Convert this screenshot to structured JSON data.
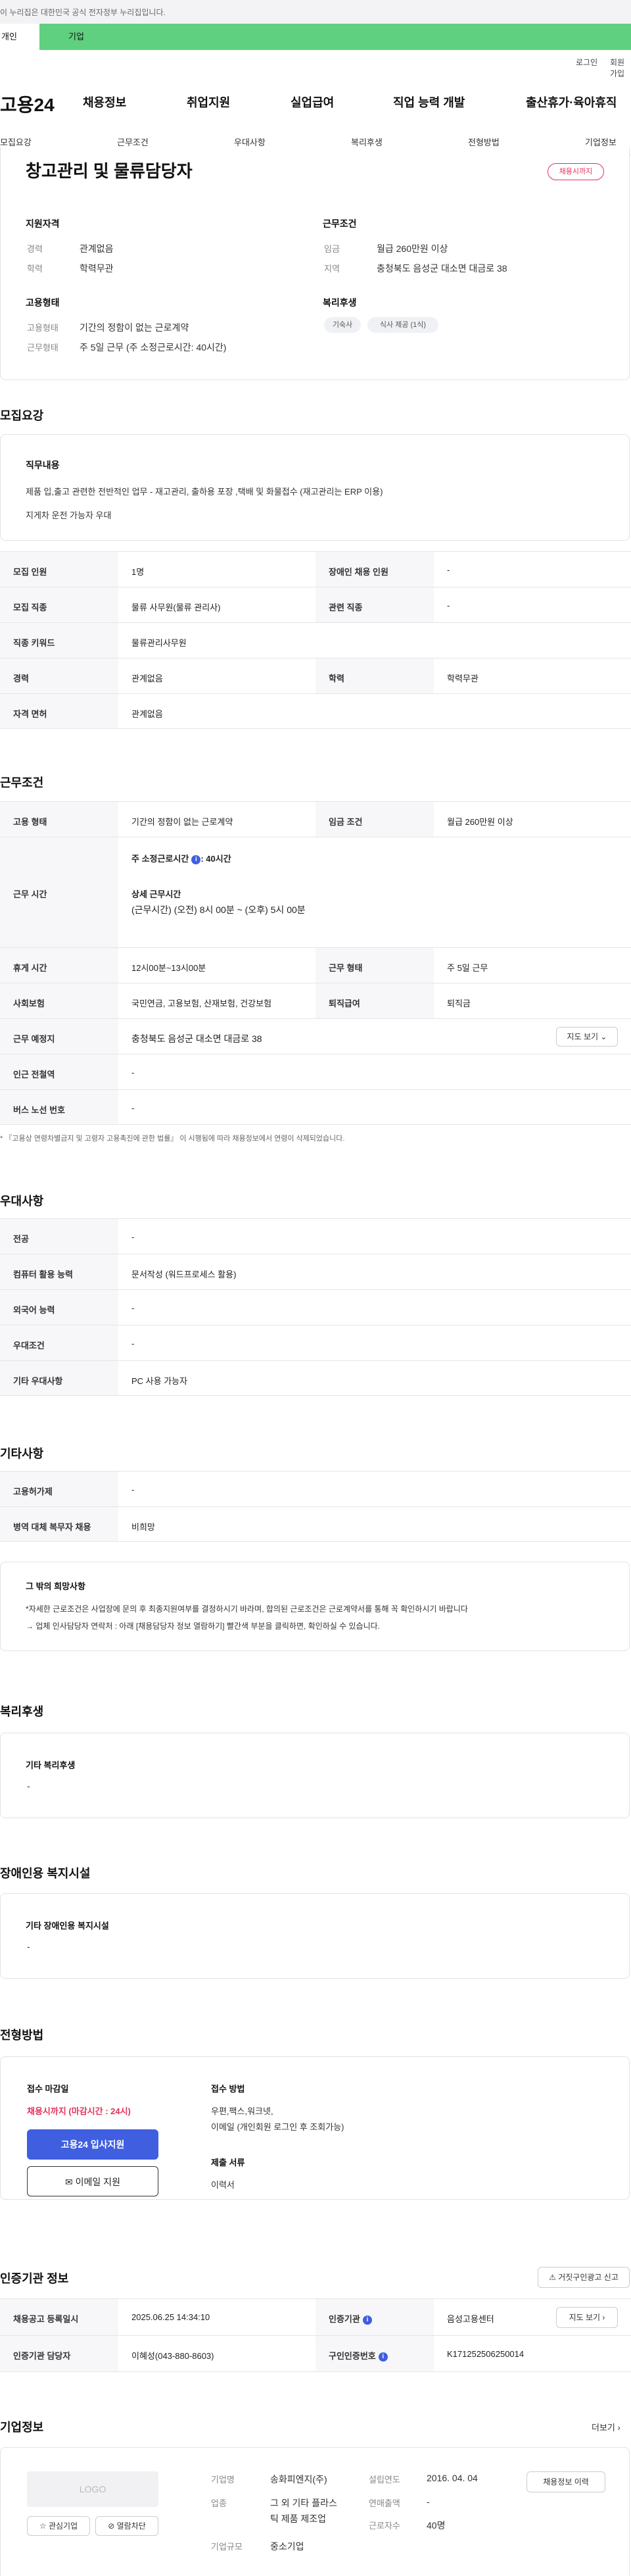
{
  "topbar": {
    "notice": "이 누리집은 대한민국 공식 전자정부 누리집입니다."
  },
  "greenbar": {
    "tab1": "개인",
    "tab2": "기업"
  },
  "utils": {
    "login": "로그인",
    "join": "회원가입"
  },
  "gnb": {
    "logo": "고용24",
    "m1": "채용정보",
    "m2": "취업지원",
    "m3": "실업급여",
    "m4": "직업 능력 개발",
    "m5": "출산휴가·육아휴직"
  },
  "anchor": {
    "a1": "모집요강",
    "a2": "근무조건",
    "a3": "우대사항",
    "a4": "복리후생",
    "a5": "전형방법",
    "a6": "기업정보"
  },
  "summary": {
    "title": "창고관리 및 물류담당자",
    "badge": "채용시까지",
    "qual_title": "지원자격",
    "career_l": "경력",
    "career_v": "관계없음",
    "edu_l": "학력",
    "edu_v": "학력무관",
    "emp_title": "고용형태",
    "emptype_l": "고용형태",
    "emptype_v": "기간의 정함이 없는 근로계약",
    "worktype_l": "근무형태",
    "worktype_v": "주 5일 근무 (주 소정근로시간: 40시간)",
    "cond_title": "근무조건",
    "wage_l": "임금",
    "wage_v": "월급 260만원 이상",
    "region_l": "지역",
    "region_v": "충청북도 음성군 대소면 대금로 38",
    "welfare_title": "복리후생",
    "chip1": "기숙사",
    "chip2": "식사 제공 (1식)"
  },
  "recruit": {
    "heading": "모집요강",
    "duty_title": "직무내용",
    "duty1": "제품 입,출고  관련한 전반적인 업무  -  재고관리, 출하용 포장 ,택배 및 화물접수 (재고관리는 ERP 이용)",
    "duty2": "지게차 운전 가능자 우대",
    "r1c1": "모집 인원",
    "r1c2": "1명",
    "r1c3": "장애인 채용 인원",
    "r1c4": "-",
    "r2c1": "모집 직종",
    "r2c2": "물류 사무원(물류 관리사)",
    "r2c3": "관련 직종",
    "r2c4": "-",
    "r3c1": "직종 키워드",
    "r3c2": "물류관리사무원",
    "r4c1": "경력",
    "r4c2": "관계없음",
    "r4c3": "학력",
    "r4c4": "학력무관",
    "r5c1": "자격 면허",
    "r5c2": "관계없음"
  },
  "work": {
    "heading": "근무조건",
    "r1c1": "고용 형태",
    "r1c2": "기간의 정함이 없는 근로계약",
    "r1c3": "임금 조건",
    "r1c4": "월급 260만원 이상",
    "r2c1": "근무 시간",
    "r2a": "주 소정근로시간",
    "r2a_v": ": 40시간",
    "r2b": "상세 근무시간",
    "r2c": "(근무시간) (오전) 8시 00분 ~ (오후) 5시 00분",
    "r3c1": "휴게 시간",
    "r3c2": "12시00분~13시00분",
    "r3c3": "근무 형태",
    "r3c4": "주 5일 근무",
    "r4c1": "사회보험",
    "r4c2": "국민연금, 고용보험, 산재보험, 건강보험",
    "r4c3": "퇴직급여",
    "r4c4": "퇴직금",
    "r5c1": "근무 예정지",
    "r5c2": "충청북도 음성군 대소면 대금로 38",
    "map_btn": "지도 보기",
    "r6c1": "인근 전철역",
    "r6c2": "-",
    "r7c1": "버스 노선 번호",
    "r7c2": "-",
    "note": "* 『고용상 연령차별금지 및 고령자 고용촉진에 관한 법률』 이 시행됨에 따라 채용정보에서 연령이 삭제되었습니다."
  },
  "pref": {
    "heading": "우대사항",
    "r1c1": "전공",
    "r1c2": "-",
    "r2c1": "컴퓨터 활용 능력",
    "r2c2": "문서작성 (워드프로세스 활용)",
    "r3c1": "외국어 능력",
    "r3c2": "-",
    "r4c1": "우대조건",
    "r4c2": "-",
    "r5c1": "기타 우대사항",
    "r5c2": "PC 사용 가능자"
  },
  "etc": {
    "heading": "기타사항",
    "r1c1": "고용허가제",
    "r1c2": "-",
    "r2c1": "병역 대체 복무자 채용",
    "r2c2": "비희망",
    "box_title": "그 밖의 희망사항",
    "box1": "*자세한 근로조건은 사업장에 문의 후 최종지원여부를 결정하시기 바라며, 합의된 근로조건은 근로계약서를 통해 꼭 확인하시기 바랍니다",
    "box2": "→ 업체 인사담당자 연락처 : 아래 [채용담당자 정보 열람하기] 빨간색 부분을 클릭하면, 확인하실 수 있습니다."
  },
  "welfare": {
    "heading": "복리후생",
    "sub": "기타 복리후생",
    "val": "-"
  },
  "disab": {
    "heading": "장애인용 복지시설",
    "sub": "기타 장애인용 복지시설",
    "val": "-"
  },
  "process": {
    "heading": "전형방법",
    "deadline_t": "접수 마감일",
    "deadline_v": "채용시까지 (마감시간 : 24시)",
    "apply_btn": "고용24 입사지원",
    "email_btn": "이메일 지원",
    "method_t": "접수 방법",
    "method_v1": "우편,팩스,워크넷,",
    "method_v2": "이메일 (개인회원 로그인 후 조회가능)",
    "docs_t": "제출 서류",
    "docs_v": "이력서"
  },
  "cert": {
    "heading": "인증기관 정보",
    "report_btn": "거짓구인광고 신고",
    "r1c1": "채용공고 등록일시",
    "r1c2": "2025.06.25 14:34:10",
    "r1c3": "인증기관",
    "r1c4": "음성고용센터",
    "detail_btn": "지도 보기",
    "r2c1": "인증기관 담당자",
    "r2c2": "이혜성(043-880-8603)",
    "r2c3": "구인인증번호",
    "r2c4": "K171252506250014"
  },
  "company": {
    "heading": "기업정보",
    "more": "더보기",
    "logo": "LOGO",
    "fav_btn": "관심기업",
    "block_btn": "열람차단",
    "n_l": "기업명",
    "n_v": "송화피엔지(주)",
    "f_l": "설립연도",
    "f_v": "2016. 04. 04",
    "i_l": "업종",
    "i_v1": "그 외 기타 플라스",
    "i_v2": "틱 제품 제조업",
    "s_l": "연매출액",
    "s_v": "-",
    "e_l": "근로자수",
    "e_v": "40명",
    "sz_l": "기업규모",
    "sz_v": "중소기업",
    "info_btn": "채용정보 이력"
  }
}
